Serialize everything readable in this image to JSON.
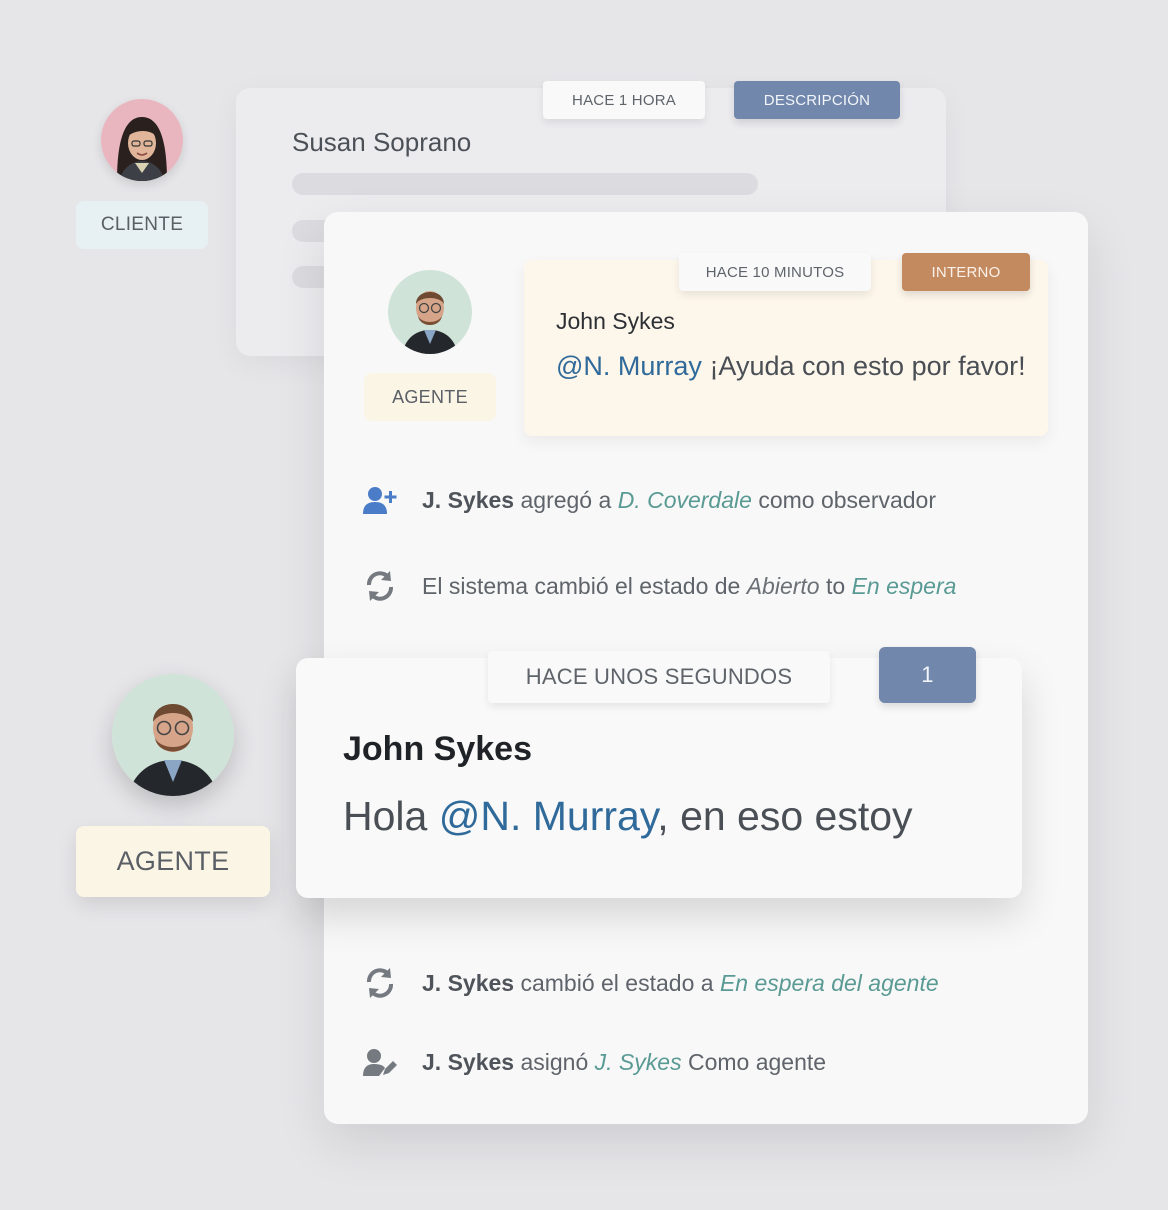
{
  "cliente": {
    "label": "CLIENTE"
  },
  "ticket": {
    "name": "Susan Soprano",
    "time_tab": "HACE 1 HORA",
    "type_tab": "DESCRIPCIÓN"
  },
  "internal_note": {
    "agent_label": "AGENTE",
    "time_tab": "HACE 10 MINUTOS",
    "type_tab": "INTERNO",
    "author": "John Sykes",
    "mention": "@N. Murray",
    "text": "¡Ayuda con esto por favor!"
  },
  "activity": [
    {
      "icon": "user-plus-icon",
      "actor": "J. Sykes",
      "verb": "agregó a",
      "target": "D. Coverdale",
      "suffix": "como observador"
    },
    {
      "icon": "sync-icon",
      "prefix": "El sistema cambió el estado de",
      "from": "Abierto",
      "to_word": "to",
      "to": "En espera"
    },
    {
      "icon": "sync-icon",
      "actor": "J. Sykes",
      "verb": "cambió el estado a",
      "target": "En espera del agente"
    },
    {
      "icon": "user-edit-icon",
      "actor": "J. Sykes",
      "verb": "asignó",
      "target": "J. Sykes",
      "suffix": "Como agente"
    }
  ],
  "reply": {
    "agent_label": "AGENTE",
    "time_tab": "HACE UNOS SEGUNDOS",
    "count_tab": "1",
    "author": "John Sykes",
    "greeting": "Hola",
    "mention": "@N. Murray",
    "text": ", en eso estoy"
  },
  "colors": {
    "background": "#e6e6e9",
    "tab_blue": "#7187ab",
    "tab_orange": "#c38a60",
    "mention_blue": "#2f6a9a",
    "status_teal": "#5a9a94",
    "icon_blue": "#4a7cc7"
  }
}
